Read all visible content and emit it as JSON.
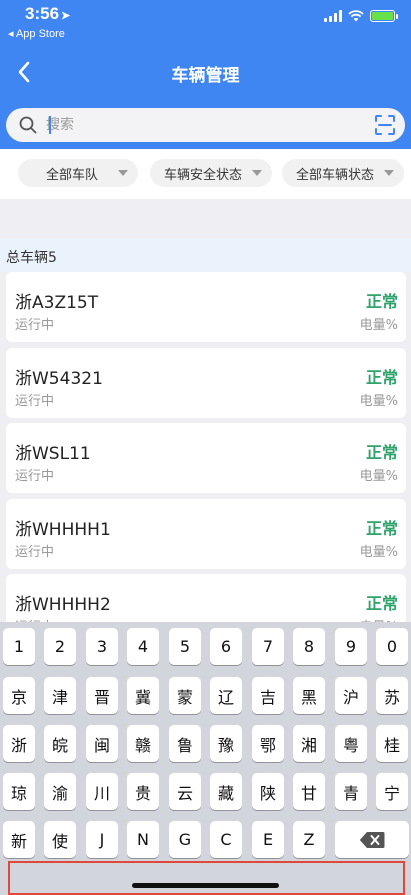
{
  "status_bar": {
    "time": "3:56",
    "back_app": "◂ App Store"
  },
  "nav": {
    "title": "车辆管理"
  },
  "search": {
    "placeholder": "搜索"
  },
  "filters": [
    "全部车队",
    "车辆安全状态",
    "全部车辆状态"
  ],
  "summary": {
    "total_label": "总车辆5"
  },
  "vehicles": [
    {
      "plate": "浙A3Z15T",
      "state": "运行中",
      "status": "正常",
      "battery": "电量%"
    },
    {
      "plate": "浙W54321",
      "state": "运行中",
      "status": "正常",
      "battery": "电量%"
    },
    {
      "plate": "浙WSL11",
      "state": "运行中",
      "status": "正常",
      "battery": "电量%"
    },
    {
      "plate": "浙WHHHH1",
      "state": "运行中",
      "status": "正常",
      "battery": "电量%"
    },
    {
      "plate": "浙WHHHH2",
      "state": "运行中",
      "status": "正常",
      "battery": "电量%"
    }
  ],
  "keyboard": {
    "row1": [
      "1",
      "2",
      "3",
      "4",
      "5",
      "6",
      "7",
      "8",
      "9",
      "0"
    ],
    "row2": [
      "京",
      "津",
      "晋",
      "冀",
      "蒙",
      "辽",
      "吉",
      "黑",
      "沪",
      "苏"
    ],
    "row3": [
      "浙",
      "皖",
      "闽",
      "赣",
      "鲁",
      "豫",
      "鄂",
      "湘",
      "粤",
      "桂"
    ],
    "row4": [
      "琼",
      "渝",
      "川",
      "贵",
      "云",
      "藏",
      "陕",
      "甘",
      "青",
      "宁"
    ],
    "row5": [
      "新",
      "使",
      "J",
      "N",
      "G",
      "C",
      "E",
      "Z"
    ]
  },
  "colors": {
    "header": "#3f86f3",
    "normal_status": "#2fa36b",
    "battery_fill": "#66e24c"
  },
  "icons": {
    "back": "chevron-left-icon",
    "search": "search-icon",
    "scan": "scan-icon",
    "delete": "backspace-icon"
  }
}
